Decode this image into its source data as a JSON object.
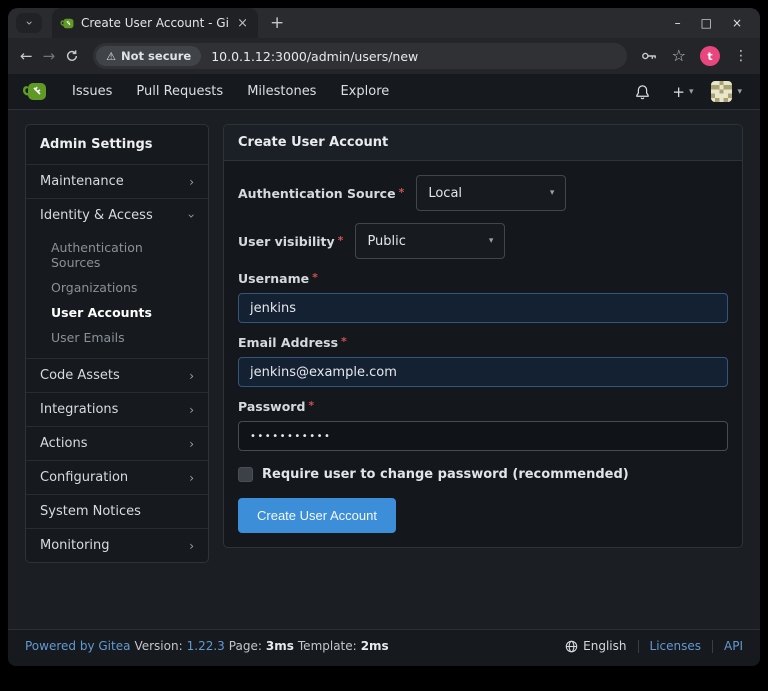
{
  "browser": {
    "tab_title": "Create User Account - Gi",
    "security_badge": "Not secure",
    "url": "10.0.1.12:3000/admin/users/new",
    "profile_initial": "t"
  },
  "icons": {
    "tab_chevron": "›",
    "tab_close": "×",
    "new_tab": "+",
    "minimize": "–",
    "maximize": "□",
    "close": "×",
    "back": "←",
    "forward": "→",
    "warning": "⚠",
    "star": "☆",
    "kebab": "⋮",
    "plus": "+",
    "caret_down": "▾",
    "chevron_right": "›"
  },
  "navbar": {
    "links": [
      {
        "label": "Issues"
      },
      {
        "label": "Pull Requests"
      },
      {
        "label": "Milestones"
      },
      {
        "label": "Explore"
      }
    ]
  },
  "sidebar": {
    "title": "Admin Settings",
    "items": [
      {
        "label": "Maintenance",
        "chevron": "right"
      },
      {
        "label": "Identity & Access",
        "chevron": "down",
        "expanded": true
      },
      {
        "label": "Code Assets",
        "chevron": "right"
      },
      {
        "label": "Integrations",
        "chevron": "right"
      },
      {
        "label": "Actions",
        "chevron": "right"
      },
      {
        "label": "Configuration",
        "chevron": "right"
      },
      {
        "label": "System Notices",
        "chevron": "none"
      },
      {
        "label": "Monitoring",
        "chevron": "right"
      }
    ],
    "identity_submenu": [
      {
        "label": "Authentication Sources",
        "active": false
      },
      {
        "label": "Organizations",
        "active": false
      },
      {
        "label": "User Accounts",
        "active": true
      },
      {
        "label": "User Emails",
        "active": false
      }
    ]
  },
  "form": {
    "panel_title": "Create User Account",
    "auth_source": {
      "label": "Authentication Source",
      "value": "Local"
    },
    "visibility": {
      "label": "User visibility",
      "value": "Public"
    },
    "username": {
      "label": "Username",
      "value": "jenkins"
    },
    "email": {
      "label": "Email Address",
      "value": "jenkins@example.com"
    },
    "password": {
      "label": "Password",
      "masked_value": "•••••••••••"
    },
    "checkbox": {
      "label": "Require user to change password (recommended)",
      "checked": false
    },
    "submit_label": "Create User Account"
  },
  "footer": {
    "powered_by": "Powered by Gitea",
    "version_label": "Version:",
    "version": "1.22.3",
    "page_label": "Page:",
    "page_time": "3ms",
    "template_label": "Template:",
    "template_time": "2ms",
    "language": "English",
    "licenses": "Licenses",
    "api": "API"
  },
  "colors": {
    "accent_blue": "#3c8ed9",
    "link_blue": "#6299d1",
    "brand_green": "#609926",
    "required_red": "#cc5450",
    "profile_pink": "#e8467c",
    "autofill_bg": "#142132",
    "autofill_border": "#35557c"
  }
}
